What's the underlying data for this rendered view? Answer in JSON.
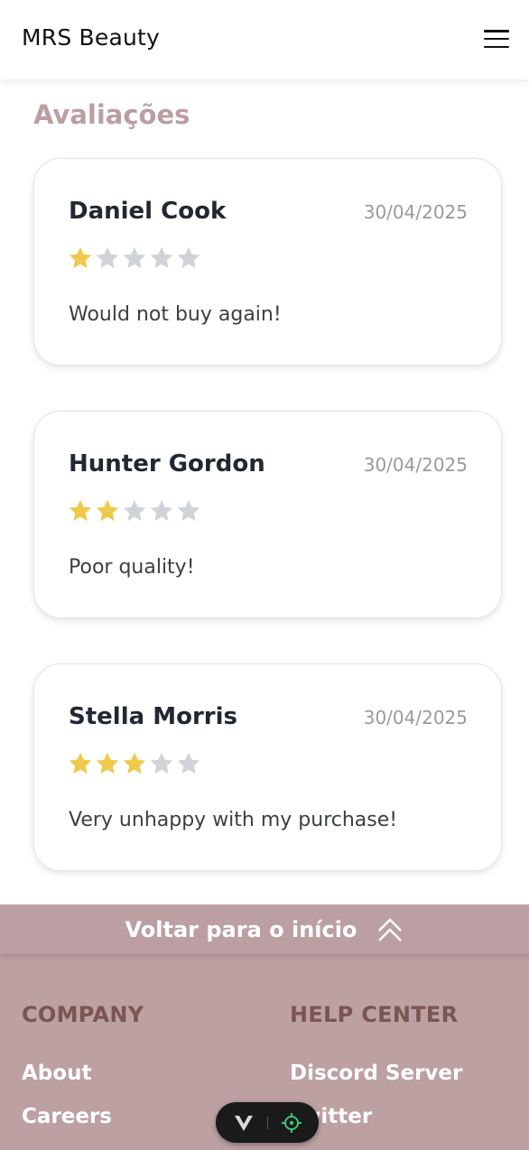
{
  "header": {
    "brand": "MRS Beauty",
    "menu_icon": "hamburger-menu-icon"
  },
  "reviews_section": {
    "title": "Avaliações",
    "star_colors": {
      "filled": "#efc94c",
      "empty": "#d0d4d9"
    },
    "reviews": [
      {
        "name": "Daniel Cook",
        "date": "30/04/2025",
        "rating": 1,
        "max_rating": 5,
        "text": "Would not buy again!"
      },
      {
        "name": "Hunter Gordon",
        "date": "30/04/2025",
        "rating": 2,
        "max_rating": 5,
        "text": "Poor quality!"
      },
      {
        "name": "Stella Morris",
        "date": "30/04/2025",
        "rating": 3,
        "max_rating": 5,
        "text": "Very unhappy with my purchase!"
      }
    ]
  },
  "back_to_top": {
    "label": "Voltar para o início",
    "icon": "double-chevron-up-icon"
  },
  "footer": {
    "columns": [
      {
        "heading": "COMPANY",
        "links": [
          "About",
          "Careers"
        ]
      },
      {
        "heading": "HELP CENTER",
        "links": [
          "Discord Server",
          "Twitter"
        ]
      }
    ]
  },
  "devtools": {
    "icons": [
      "vue-logo-icon",
      "crosshair-icon"
    ]
  },
  "colors": {
    "accent": "#bc9fa2",
    "footer_heading": "#7b5552",
    "text_dark": "#222831",
    "date_gray": "#9a9a9a"
  }
}
